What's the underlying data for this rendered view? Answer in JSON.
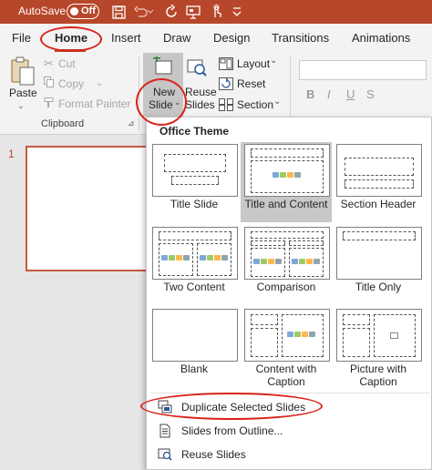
{
  "titlebar": {
    "autosave_label": "AutoSave",
    "autosave_state": "Off",
    "accent_color": "#b7472a"
  },
  "quick_access_icons": [
    "save-icon",
    "undo-icon",
    "redo-icon",
    "start-slideshow-icon",
    "touch-mode-icon",
    "customize-chevron-icon"
  ],
  "tabs": [
    {
      "label": "File"
    },
    {
      "label": "Home",
      "active": true
    },
    {
      "label": "Insert"
    },
    {
      "label": "Draw"
    },
    {
      "label": "Design"
    },
    {
      "label": "Transitions"
    },
    {
      "label": "Animations"
    }
  ],
  "ribbon": {
    "clipboard": {
      "paste_label": "Paste",
      "cut_label": "Cut",
      "copy_label": "Copy",
      "format_painter_label": "Format Painter",
      "group_label": "Clipboard"
    },
    "slides": {
      "new_slide_label_line1": "New",
      "new_slide_label_line2": "Slide",
      "reuse_slides_label_line1": "Reuse",
      "reuse_slides_label_line2": "Slides",
      "layout_label": "Layout",
      "reset_label": "Reset",
      "section_label": "Section"
    },
    "font": {
      "bold_glyph": "B",
      "italic_glyph": "I",
      "underline_glyph": "U",
      "strike_glyph": "S"
    }
  },
  "slide_panel": {
    "slide_number": "1"
  },
  "new_slide_menu": {
    "heading": "Office Theme",
    "layouts": [
      {
        "label": "Title Slide"
      },
      {
        "label": "Title and Content",
        "selected": true
      },
      {
        "label": "Section Header"
      },
      {
        "label": "Two Content"
      },
      {
        "label": "Comparison"
      },
      {
        "label": "Title Only"
      },
      {
        "label": "Blank"
      },
      {
        "label_line1": "Content with",
        "label_line2": "Caption"
      },
      {
        "label_line1": "Picture with",
        "label_line2": "Caption"
      }
    ],
    "actions": [
      {
        "label": "Duplicate Selected Slides",
        "icon": "duplicate-slides-icon"
      },
      {
        "label": "Slides from Outline...",
        "icon": "outline-document-icon"
      },
      {
        "label": "Reuse Slides",
        "icon": "reuse-slides-icon"
      }
    ]
  },
  "annotation_color": "#d9241a"
}
